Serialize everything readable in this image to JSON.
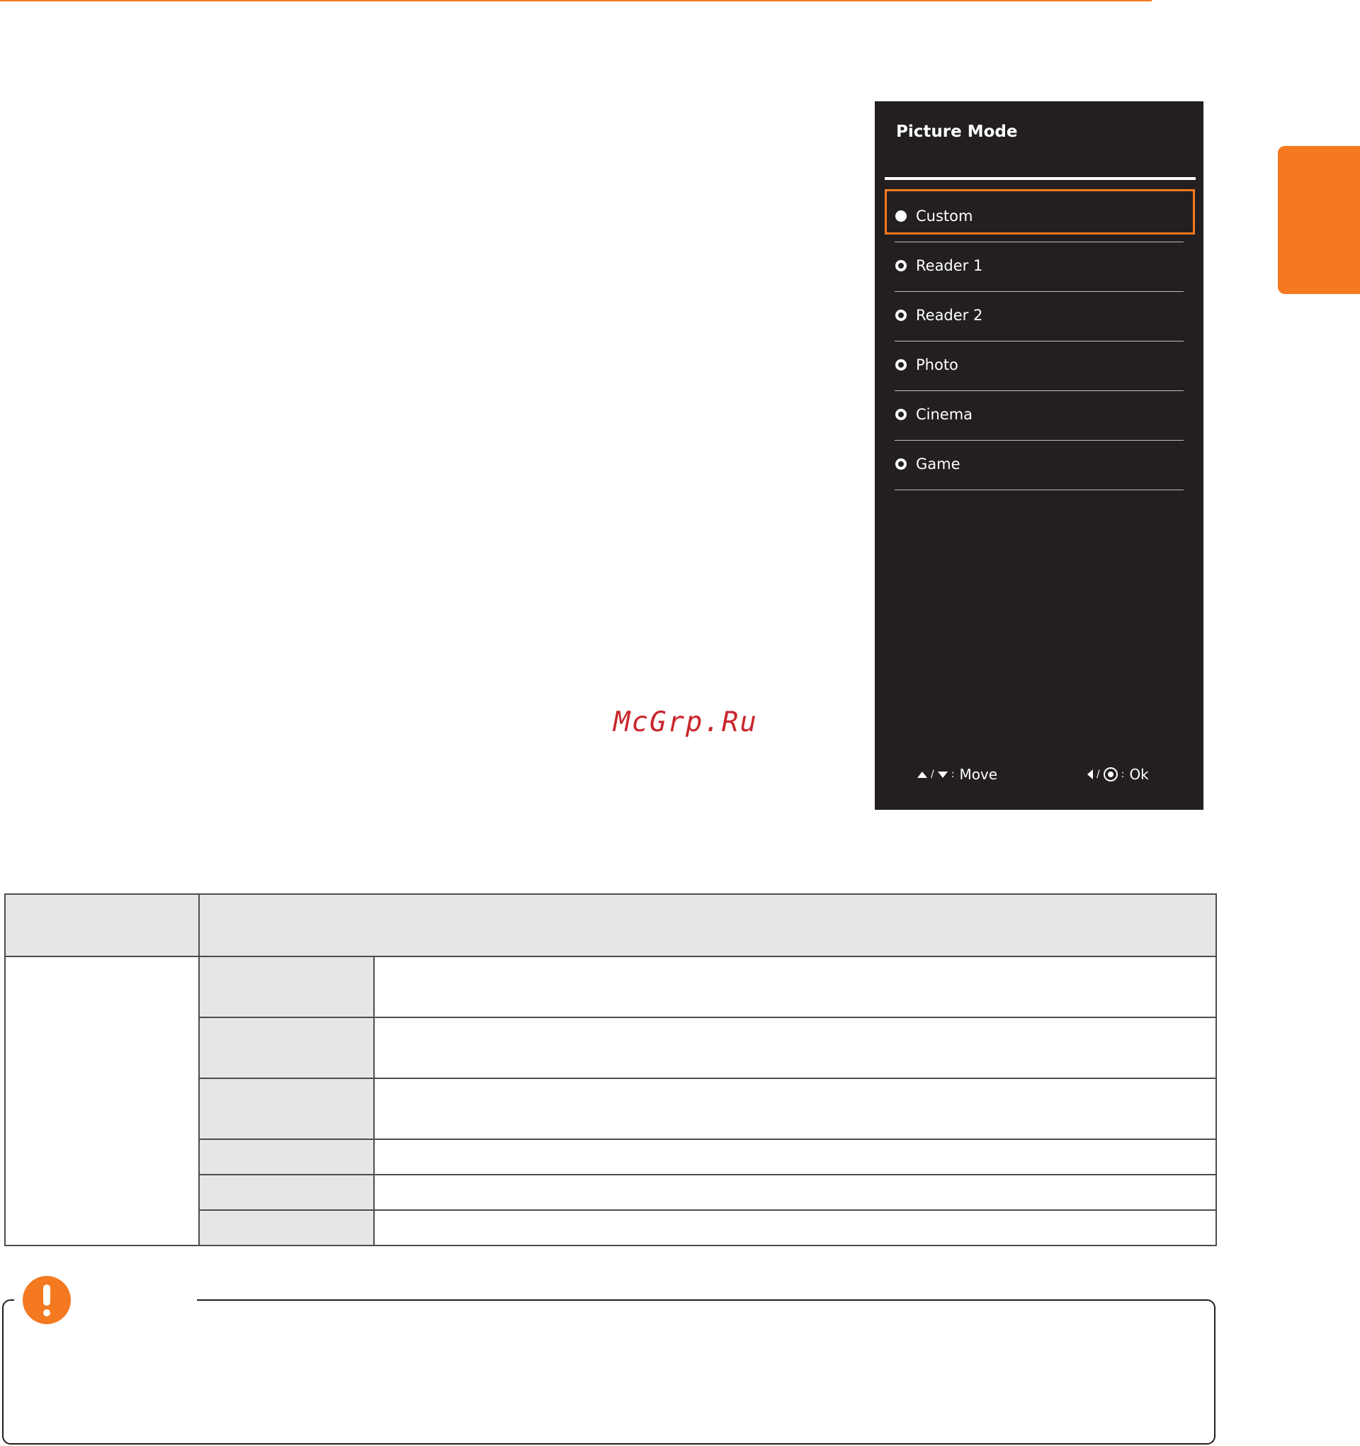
{
  "watermark": "McGrp.Ru",
  "osd": {
    "title": "Picture Mode",
    "items": [
      {
        "label": "Custom",
        "selected": true
      },
      {
        "label": "Reader 1",
        "selected": false
      },
      {
        "label": "Reader 2",
        "selected": false
      },
      {
        "label": "Photo",
        "selected": false
      },
      {
        "label": "Cinema",
        "selected": false
      },
      {
        "label": "Game",
        "selected": false
      }
    ],
    "footer": {
      "move_slash": "/",
      "move_colon": ":",
      "move_label": "Move",
      "ok_slash": "/",
      "ok_colon": ":",
      "ok_label": "Ok"
    }
  },
  "colors": {
    "accent": "#f47920",
    "panel": "#231f20",
    "table_header": "#e6e6e6"
  },
  "icons": [
    "caution-icon",
    "arrow-up-icon",
    "arrow-down-icon",
    "arrow-left-icon",
    "joystick-button-icon"
  ]
}
